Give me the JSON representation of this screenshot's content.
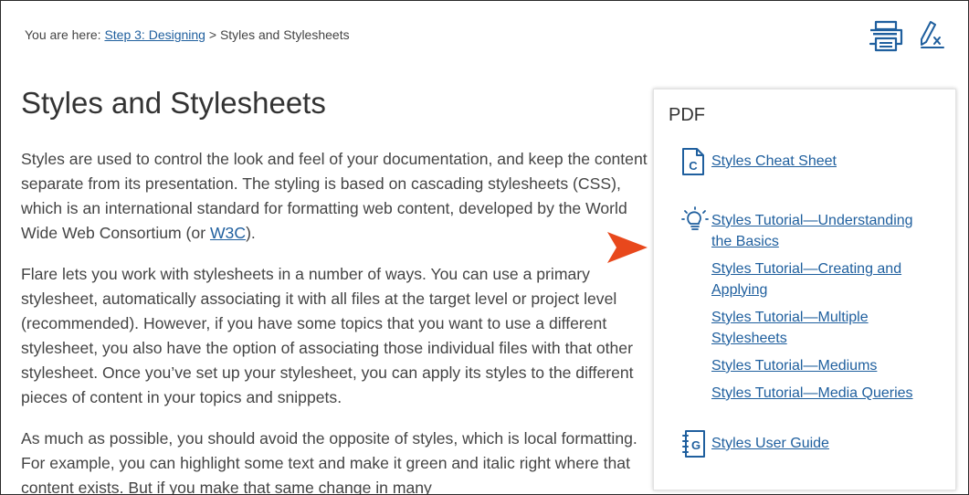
{
  "breadcrumb": {
    "prefix": "You are here: ",
    "link": "Step 3: Designing",
    "separator": " > ",
    "current": "Styles and Stylesheets"
  },
  "toolbar": {
    "print_icon": "print-icon",
    "clear_highlight_icon": "clear-highlight-icon"
  },
  "main": {
    "title": "Styles and Stylesheets",
    "paragraph1_before_link": "Styles are used to control the look and feel of your documentation, and keep the content separate from its presentation. The styling is based on cascading stylesheets (CSS), which is an international standard for formatting web content, developed by the World Wide Web Consortium (or ",
    "paragraph1_link": "W3C",
    "paragraph1_after_link": ").",
    "paragraph2": "Flare lets you work with stylesheets in a number of ways. You can use a primary stylesheet, automatically associating it with all files at the target level or project level (recommended). However, if you have some topics that you want to use a different stylesheet, you also have the option of associating those individual files with that other stylesheet. Once you’ve set up your stylesheet, you can apply its styles to the different pieces of content in your topics and snippets.",
    "paragraph3": "As much as possible, you should avoid the opposite of styles, which is local formatting. For example, you can highlight some text and make it green and italic right where that content exists. But if you make that same change in many"
  },
  "pdf_panel": {
    "heading": "PDF",
    "cheat_sheet_icon_letter": "C",
    "cheat_sheet": "Styles Cheat Sheet",
    "tutorials": [
      "Styles Tutorial—Understanding the Basics",
      "Styles Tutorial—Creating and Applying",
      "Styles Tutorial—Multiple Stylesheets",
      "Styles Tutorial—Mediums",
      "Styles Tutorial—Media Queries"
    ],
    "guide_icon_letter": "G",
    "user_guide": "Styles User Guide"
  },
  "colors": {
    "link": "#1f5f9e",
    "icon": "#1f5f9e",
    "arrow": "#e8481c"
  }
}
